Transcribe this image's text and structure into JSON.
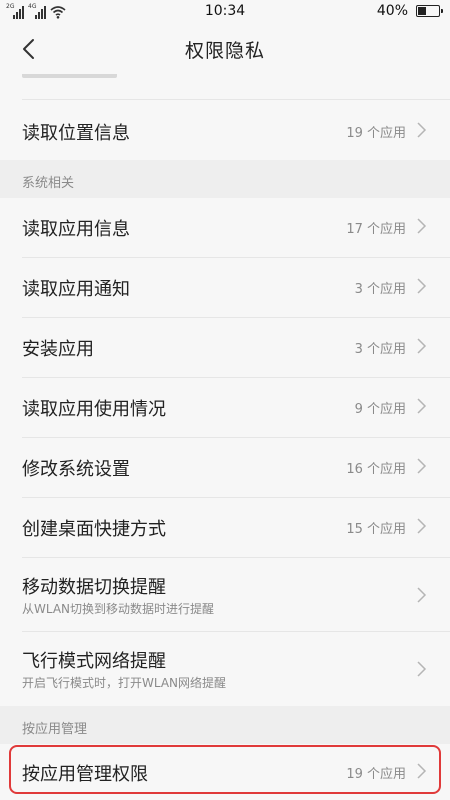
{
  "status_bar": {
    "signal_1_label": "2G",
    "signal_2_label": "4G",
    "time": "10:34",
    "battery_percent": "40%",
    "battery_level": 0.4
  },
  "header": {
    "title": "权限隐私"
  },
  "rows_top": {
    "location": {
      "label": "读取位置信息",
      "count": "19 个应用"
    }
  },
  "sections": {
    "system": "系统相关",
    "by_app": "按应用管理"
  },
  "system_items": [
    {
      "label": "读取应用信息",
      "count": "17 个应用"
    },
    {
      "label": "读取应用通知",
      "count": "3 个应用"
    },
    {
      "label": "安装应用",
      "count": "3 个应用"
    },
    {
      "label": "读取应用使用情况",
      "count": "9 个应用"
    },
    {
      "label": "修改系统设置",
      "count": "16 个应用"
    },
    {
      "label": "创建桌面快捷方式",
      "count": "15 个应用"
    },
    {
      "label": "移动数据切换提醒",
      "sub": "从WLAN切换到移动数据时进行提醒"
    },
    {
      "label": "飞行模式网络提醒",
      "sub": "开启飞行模式时，打开WLAN网络提醒"
    }
  ],
  "by_app_items": [
    {
      "label": "按应用管理权限",
      "count": "19 个应用"
    }
  ],
  "colors": {
    "highlight": "#e03a3a",
    "background": "#f2f2f2",
    "row_bg": "#f7f7f7"
  },
  "icons": {
    "back": "chevron-left-icon",
    "row_arrow": "chevron-right-icon"
  }
}
